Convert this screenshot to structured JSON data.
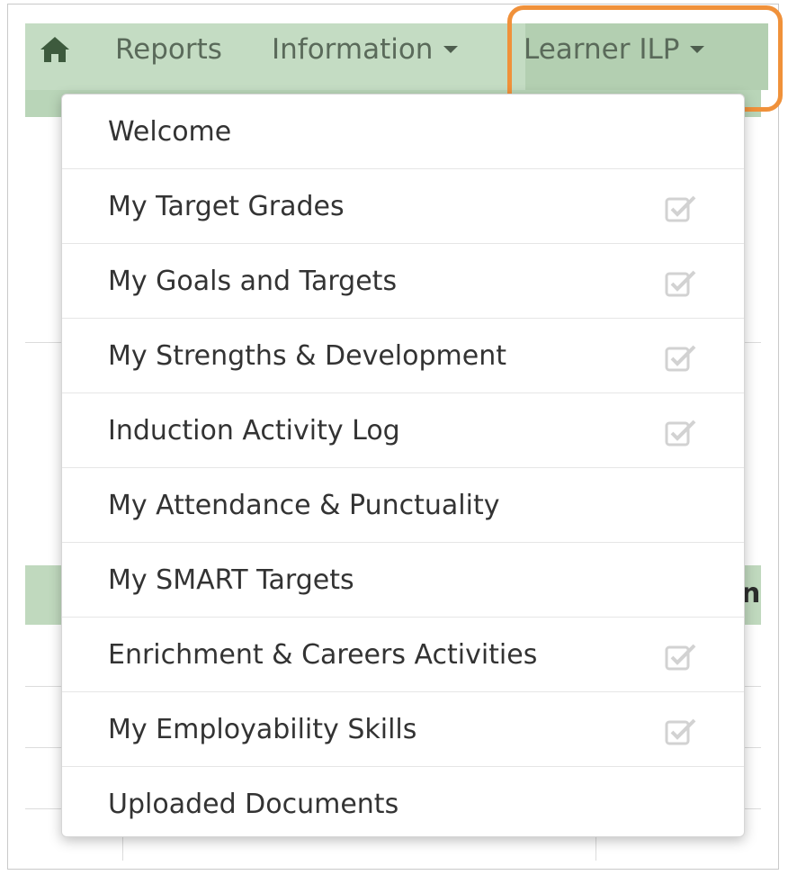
{
  "nav": {
    "home_icon": "home-icon",
    "reports": "Reports",
    "information": "Information",
    "learner_ilp": "Learner ILP"
  },
  "menu": {
    "items": [
      {
        "label": "Welcome",
        "checked_icon": false
      },
      {
        "label": "My Target Grades",
        "checked_icon": true
      },
      {
        "label": "My Goals and Targets",
        "checked_icon": true
      },
      {
        "label": "My Strengths & Development",
        "checked_icon": true
      },
      {
        "label": "Induction Activity Log",
        "checked_icon": true
      },
      {
        "label": "My Attendance & Punctuality",
        "checked_icon": false
      },
      {
        "label": "My SMART Targets",
        "checked_icon": false
      },
      {
        "label": "Enrichment & Careers Activities",
        "checked_icon": true
      },
      {
        "label": "My Employability Skills",
        "checked_icon": true
      },
      {
        "label": "Uploaded Documents",
        "checked_icon": false
      }
    ]
  },
  "background_table": {
    "header_fragment": "nu"
  },
  "colors": {
    "navbar": "#c4dcc3",
    "highlight": "#f0913a",
    "table_header": "#c0d9be"
  }
}
